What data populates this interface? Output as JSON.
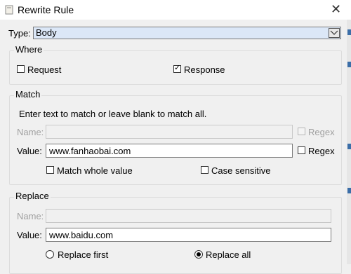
{
  "window": {
    "title": "Rewrite Rule"
  },
  "type": {
    "label": "Type:",
    "value": "Body"
  },
  "where": {
    "title": "Where",
    "request": {
      "label": "Request",
      "checked": false
    },
    "response": {
      "label": "Response",
      "checked": true
    }
  },
  "match": {
    "title": "Match",
    "instructions": "Enter text to match or leave blank to match all.",
    "name": {
      "label": "Name:",
      "value": "",
      "regex_label": "Regex",
      "enabled": false
    },
    "value": {
      "label": "Value:",
      "value": "www.fanhaobai.com",
      "regex_label": "Regex",
      "regex_checked": false
    },
    "whole_value": {
      "label": "Match whole value",
      "checked": false
    },
    "case_sensitive": {
      "label": "Case sensitive",
      "checked": false
    }
  },
  "replace": {
    "title": "Replace",
    "name": {
      "label": "Name:",
      "value": ""
    },
    "value": {
      "label": "Value:",
      "value": "www.baidu.com"
    },
    "replace_first": {
      "label": "Replace first",
      "selected": false
    },
    "replace_all": {
      "label": "Replace all",
      "selected": true
    }
  },
  "colors": {
    "accent": "#3b6ea8",
    "select_bg": "#dbe7f7"
  }
}
